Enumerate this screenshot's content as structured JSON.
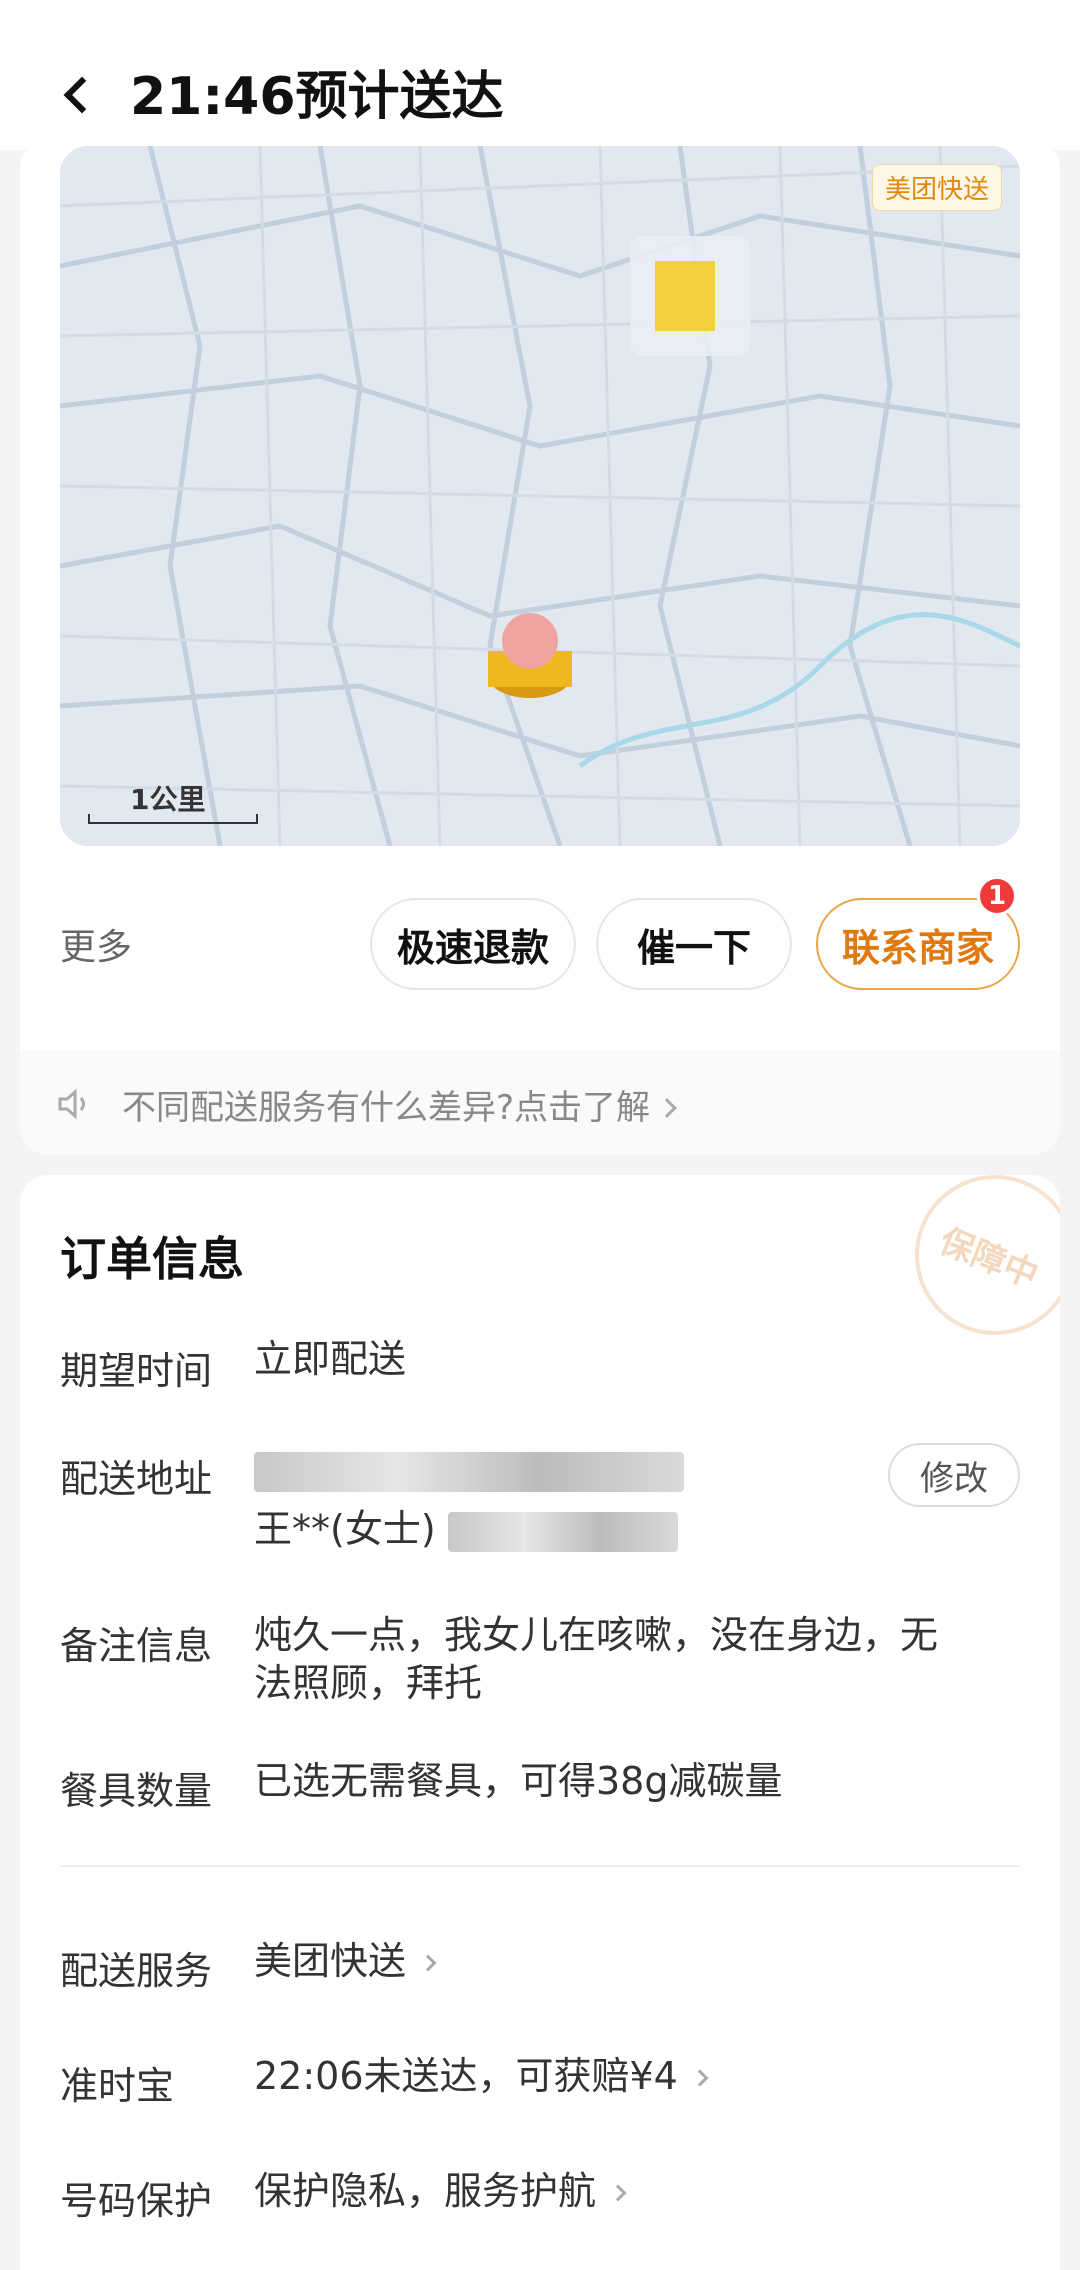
{
  "header": {
    "title": "21:46预计送达"
  },
  "map": {
    "badge": "美团快送",
    "scale_label": "1公里"
  },
  "actions": {
    "more": "更多",
    "refund": "极速退款",
    "urge": "催一下",
    "contact": "联系商家",
    "contact_badge": "1"
  },
  "tip": {
    "text": "不同配送服务有什么差异?点击了解"
  },
  "order": {
    "title": "订单信息",
    "stamp": "保障中",
    "expected_time": {
      "label": "期望时间",
      "value": "立即配送"
    },
    "address": {
      "label": "配送地址",
      "name": "王**(女士)",
      "edit": "修改"
    },
    "remark": {
      "label": "备注信息",
      "line1": "炖久一点，我女儿在咳嗽，没在身边，无",
      "line2": "法照顾，拜托"
    },
    "tableware": {
      "label": "餐具数量",
      "value": "已选无需餐具，可得38g减碳量"
    },
    "service": {
      "label": "配送服务",
      "value": "美团快送"
    },
    "ontime": {
      "label": "准时宝",
      "value": "22:06未送达，可获赔¥4"
    },
    "privacy": {
      "label": "号码保护",
      "value": "保护隐私，服务护航"
    }
  },
  "colors": {
    "accent": "#e07a10",
    "badge_red": "#ee3a3a"
  }
}
